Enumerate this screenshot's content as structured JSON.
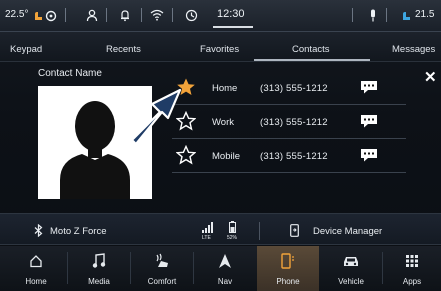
{
  "status_bar": {
    "temperature_left": "22.5°",
    "clock": "12:30",
    "temperature_right": "21.5"
  },
  "tabs": [
    {
      "label": "Keypad"
    },
    {
      "label": "Recents"
    },
    {
      "label": "Favorites"
    },
    {
      "label": "Contacts",
      "active": true
    },
    {
      "label": "Messages"
    }
  ],
  "contact": {
    "name_label": "Contact Name",
    "numbers": [
      {
        "type": "Home",
        "number": "(313) 555-1212",
        "favorite": true
      },
      {
        "type": "Work",
        "number": "(313) 555-1212",
        "favorite": false
      },
      {
        "type": "Mobile",
        "number": "(313) 555-1212",
        "favorite": false
      }
    ]
  },
  "device_bar": {
    "device_name": "Moto Z Force",
    "signal_label": "LTE",
    "battery_label": "52%",
    "device_manager_label": "Device Manager"
  },
  "nav": [
    {
      "label": "Home",
      "icon": "home-icon"
    },
    {
      "label": "Media",
      "icon": "music-note-icon"
    },
    {
      "label": "Comfort",
      "icon": "seat-heat-icon"
    },
    {
      "label": "Nav",
      "icon": "navigation-arrow-icon"
    },
    {
      "label": "Phone",
      "icon": "phone-icon",
      "active": true
    },
    {
      "label": "Vehicle",
      "icon": "car-icon"
    },
    {
      "label": "Apps",
      "icon": "apps-grid-icon"
    }
  ],
  "colors": {
    "accent_star": "#f2a33a",
    "active_nav": "#5a4a38",
    "callout_arrow": "#1f3c66"
  }
}
